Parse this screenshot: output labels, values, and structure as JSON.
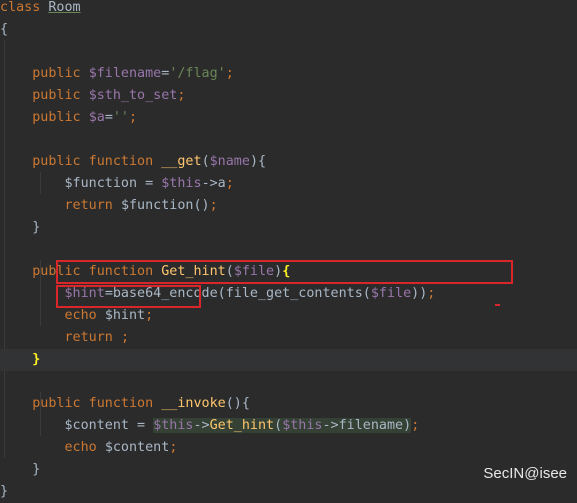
{
  "editor": {
    "theme_colors": {
      "background": "#2b2b2b",
      "current_line": "#313335",
      "keyword": "#cc7832",
      "variable": "#9876aa",
      "string": "#6a8759",
      "function": "#ffc66d",
      "text": "#a9b7c6",
      "annotation_box": "#d9262b"
    },
    "lines": [
      {
        "tokens": [
          {
            "t": "class ",
            "c": "kw"
          },
          {
            "t": "Room",
            "c": "cls"
          }
        ]
      },
      {
        "tokens": [
          {
            "t": "{",
            "c": "plain"
          }
        ]
      },
      {
        "tokens": []
      },
      {
        "tokens": [
          {
            "t": "    public ",
            "c": "kw"
          },
          {
            "t": "$filename",
            "c": "var"
          },
          {
            "t": "=",
            "c": "plain"
          },
          {
            "t": "'/flag'",
            "c": "str"
          },
          {
            "t": ";",
            "c": "kw"
          }
        ]
      },
      {
        "tokens": [
          {
            "t": "    public ",
            "c": "kw"
          },
          {
            "t": "$sth_to_set",
            "c": "var"
          },
          {
            "t": ";",
            "c": "kw"
          }
        ]
      },
      {
        "tokens": [
          {
            "t": "    public ",
            "c": "kw"
          },
          {
            "t": "$a",
            "c": "var"
          },
          {
            "t": "=",
            "c": "plain"
          },
          {
            "t": "''",
            "c": "str"
          },
          {
            "t": ";",
            "c": "kw"
          }
        ]
      },
      {
        "tokens": []
      },
      {
        "tokens": [
          {
            "t": "    public function ",
            "c": "kw"
          },
          {
            "t": "__get",
            "c": "fn"
          },
          {
            "t": "(",
            "c": "plain"
          },
          {
            "t": "$name",
            "c": "var"
          },
          {
            "t": "){",
            "c": "plain"
          }
        ]
      },
      {
        "tokens": [
          {
            "t": "        ",
            "c": "plain"
          },
          {
            "t": "$function",
            "c": "plain"
          },
          {
            "t": " = ",
            "c": "plain"
          },
          {
            "t": "$this",
            "c": "var"
          },
          {
            "t": "->a",
            "c": "plain"
          },
          {
            "t": ";",
            "c": "kw"
          }
        ]
      },
      {
        "tokens": [
          {
            "t": "        return ",
            "c": "kw"
          },
          {
            "t": "$function",
            "c": "plain"
          },
          {
            "t": "()",
            "c": "plain"
          },
          {
            "t": ";",
            "c": "kw"
          }
        ]
      },
      {
        "tokens": [
          {
            "t": "    }",
            "c": "plain"
          }
        ]
      },
      {
        "tokens": []
      },
      {
        "tokens": [
          {
            "t": "    public function ",
            "c": "kw"
          },
          {
            "t": "Get_hint",
            "c": "fn"
          },
          {
            "t": "(",
            "c": "plain"
          },
          {
            "t": "$file",
            "c": "var"
          },
          {
            "t": ")",
            "c": "plain"
          },
          {
            "t": "{",
            "c": "brace"
          }
        ]
      },
      {
        "tokens": [
          {
            "t": "        ",
            "c": "plain"
          },
          {
            "t": "$hint",
            "c": "var"
          },
          {
            "t": "=base64_encode(file_get_contents(",
            "c": "plain"
          },
          {
            "t": "$file",
            "c": "var"
          },
          {
            "t": "))",
            "c": "plain"
          },
          {
            "t": ";",
            "c": "kw"
          }
        ]
      },
      {
        "tokens": [
          {
            "t": "        echo ",
            "c": "kw"
          },
          {
            "t": "$hint",
            "c": "plain"
          },
          {
            "t": ";",
            "c": "kw"
          }
        ]
      },
      {
        "tokens": [
          {
            "t": "        return ",
            "c": "kw"
          },
          {
            "t": ";",
            "c": "kw"
          }
        ]
      },
      {
        "tokens": [
          {
            "t": "    ",
            "c": "plain"
          },
          {
            "t": "}",
            "c": "brace"
          }
        ],
        "current": true
      },
      {
        "tokens": []
      },
      {
        "tokens": [
          {
            "t": "    public function ",
            "c": "kw"
          },
          {
            "t": "__invoke",
            "c": "fn"
          },
          {
            "t": "(){",
            "c": "plain"
          }
        ]
      },
      {
        "tokens": [
          {
            "t": "        ",
            "c": "plain"
          },
          {
            "t": "$content",
            "c": "plain"
          },
          {
            "t": " = ",
            "c": "plain"
          },
          {
            "t": "$this",
            "c": "var-hl"
          },
          {
            "t": "->",
            "c": "plain-hl"
          },
          {
            "t": "Get_hint",
            "c": "fn-hl"
          },
          {
            "t": "(",
            "c": "plain-hl"
          },
          {
            "t": "$this",
            "c": "var-hl"
          },
          {
            "t": "->filename",
            "c": "plain-hl"
          },
          {
            "t": ")",
            "c": "plain-hl"
          },
          {
            "t": ";",
            "c": "kw"
          }
        ]
      },
      {
        "tokens": [
          {
            "t": "        echo ",
            "c": "kw"
          },
          {
            "t": "$content",
            "c": "plain"
          },
          {
            "t": ";",
            "c": "kw"
          }
        ]
      },
      {
        "tokens": [
          {
            "t": "    }",
            "c": "plain"
          }
        ]
      },
      {
        "tokens": [
          {
            "t": "}",
            "c": "plain"
          }
        ]
      }
    ]
  },
  "watermark": {
    "text": "SecIN@isee"
  }
}
